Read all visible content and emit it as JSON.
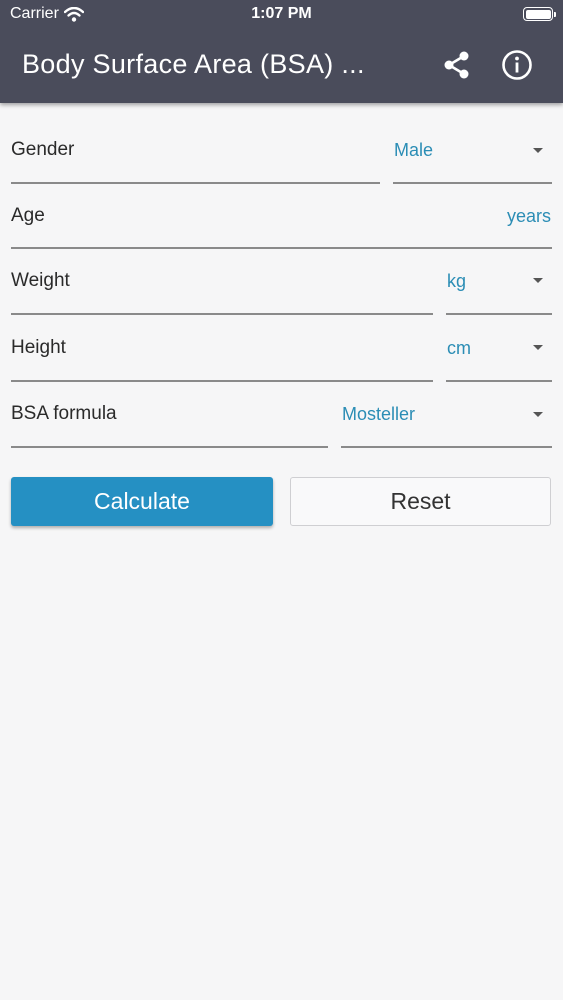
{
  "status_bar": {
    "carrier": "Carrier",
    "time": "1:07 PM"
  },
  "app_bar": {
    "title": "Body Surface Area (BSA) ...",
    "share_icon": "share-icon",
    "info_icon": "info-icon"
  },
  "form": {
    "gender": {
      "label": "Gender",
      "value": "Male"
    },
    "age": {
      "label": "Age",
      "unit": "years"
    },
    "weight": {
      "label": "Weight",
      "unit": "kg"
    },
    "height": {
      "label": "Height",
      "unit": "cm"
    },
    "formula": {
      "label": "BSA formula",
      "value": "Mosteller"
    }
  },
  "buttons": {
    "calculate": "Calculate",
    "reset": "Reset"
  },
  "colors": {
    "app_bar": "#4a4c5b",
    "accent": "#2590c3",
    "unit_text": "#2b8db5",
    "background": "#f6f6f7"
  }
}
